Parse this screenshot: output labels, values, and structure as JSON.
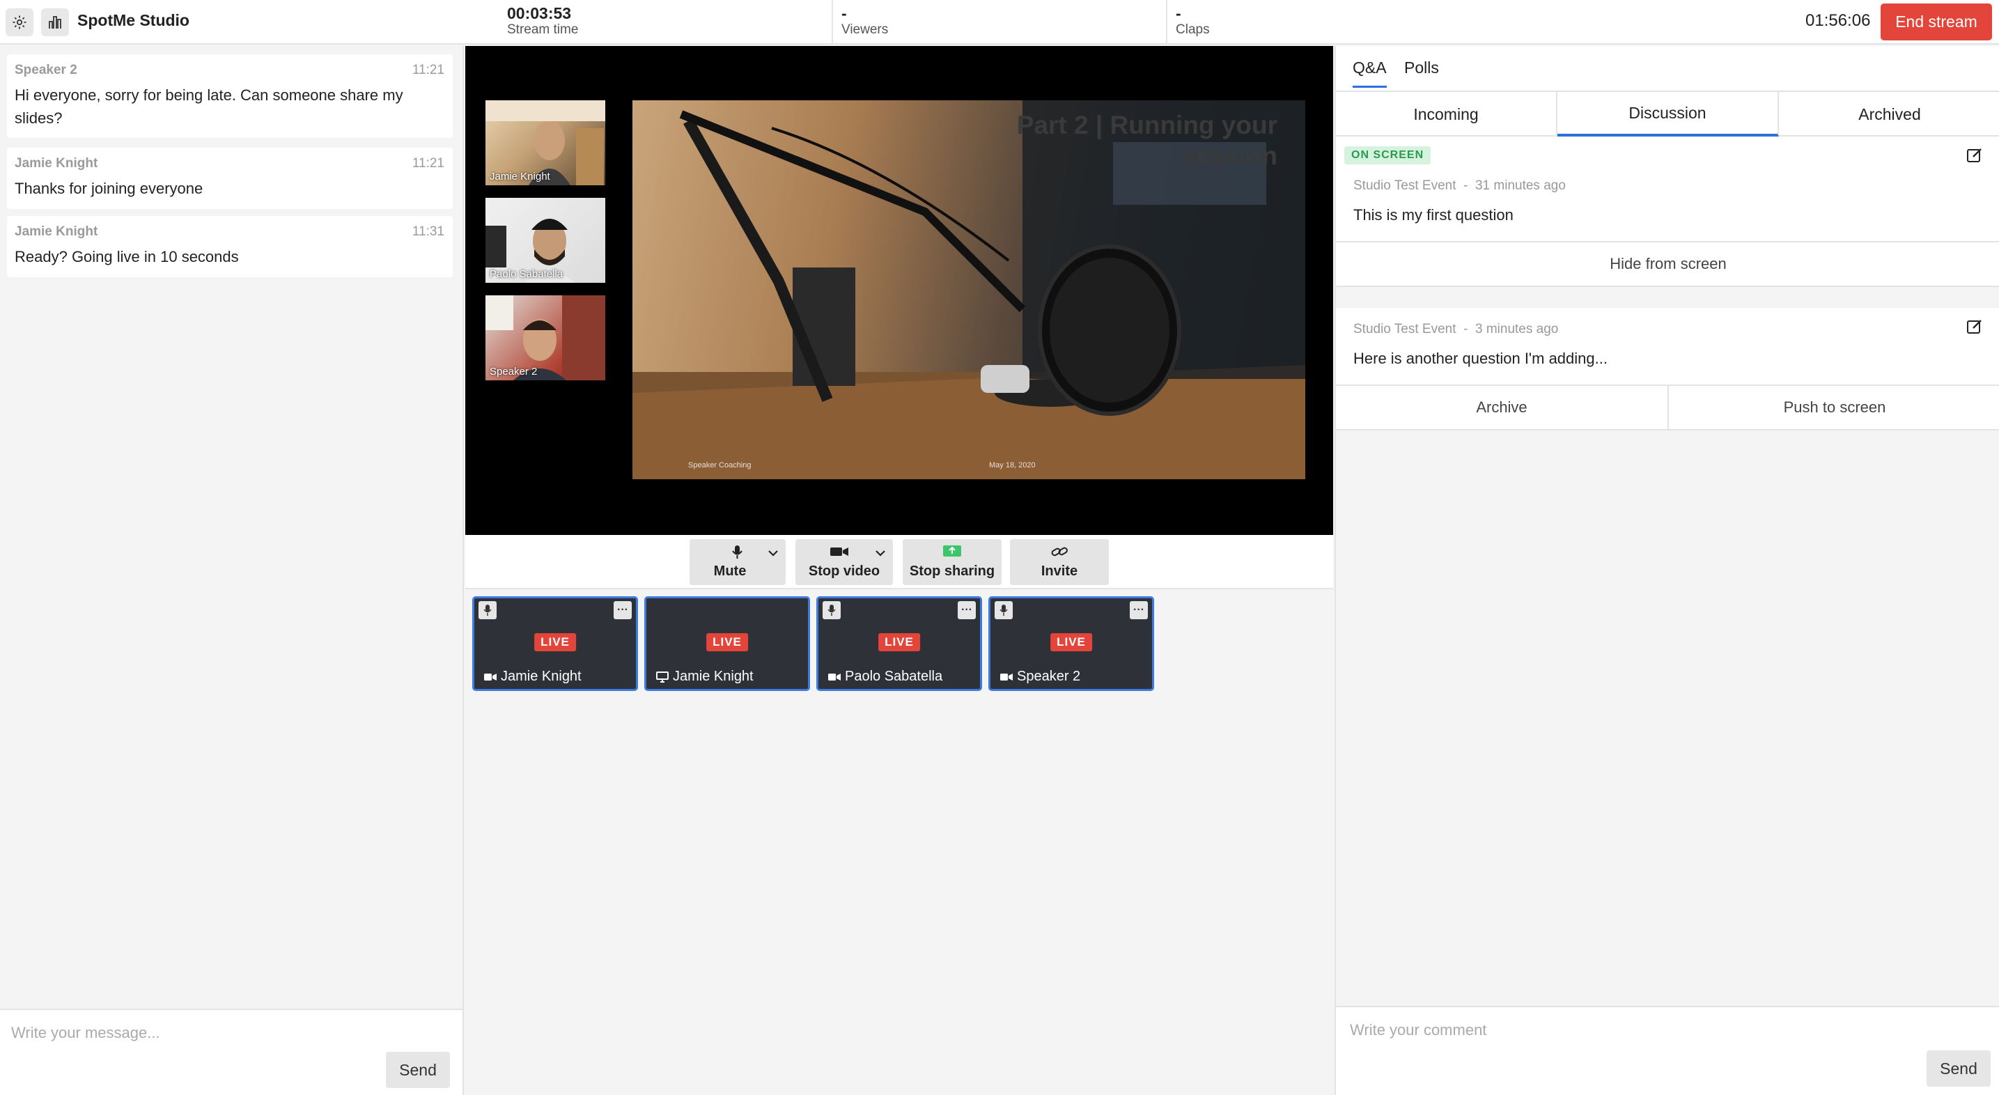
{
  "app": {
    "name": "SpotMe Studio"
  },
  "topbar": {
    "stream_time_value": "00:03:53",
    "stream_time_label": "Stream time",
    "viewers_value": "-",
    "viewers_label": "Viewers",
    "claps_value": "-",
    "claps_label": "Claps",
    "clock": "01:56:06",
    "end_stream_label": "End stream",
    "icons": [
      "gear-icon",
      "bar-chart-icon"
    ]
  },
  "chat": {
    "messages": [
      {
        "author": "Speaker 2",
        "time": "11:21",
        "text": "Hi everyone, sorry for being late. Can someone share my slides?"
      },
      {
        "author": "Jamie Knight",
        "time": "11:21",
        "text": "Thanks for joining everyone"
      },
      {
        "author": "Jamie Knight",
        "time": "11:31",
        "text": "Ready? Going live in 10 seconds"
      }
    ],
    "placeholder": "Write your message...",
    "send_label": "Send"
  },
  "stage": {
    "thumbnails": [
      {
        "name": "Jamie Knight"
      },
      {
        "name": "Paolo Sabatella"
      },
      {
        "name": "Speaker 2"
      }
    ],
    "slide": {
      "title": "Part 2 | Running your session",
      "footer_left": "Speaker Coaching",
      "footer_right": "May 18, 2020"
    }
  },
  "controls": {
    "mute_label": "Mute",
    "stop_video_label": "Stop video",
    "stop_sharing_label": "Stop sharing",
    "invite_label": "Invite"
  },
  "tiles": [
    {
      "name": "Jamie Knight",
      "badge": "LIVE",
      "source": "camera-icon",
      "has_mic": true,
      "has_menu": true
    },
    {
      "name": "Jamie Knight",
      "badge": "LIVE",
      "source": "screen-icon",
      "has_mic": false,
      "has_menu": false
    },
    {
      "name": "Paolo Sabatella",
      "badge": "LIVE",
      "source": "camera-icon",
      "has_mic": true,
      "has_menu": true
    },
    {
      "name": "Speaker 2",
      "badge": "LIVE",
      "source": "camera-icon",
      "has_mic": true,
      "has_menu": true
    }
  ],
  "qa": {
    "tabs": [
      "Q&A",
      "Polls"
    ],
    "subtabs": [
      "Incoming",
      "Discussion",
      "Archived"
    ],
    "active_subtab": "Discussion",
    "questions": [
      {
        "status": "ON SCREEN",
        "source": "Studio Test Event",
        "separator": "-",
        "age": "31 minutes ago",
        "text": "This is my first question",
        "action": "Hide from screen"
      },
      {
        "source": "Studio Test Event",
        "separator": "-",
        "age": "3 minutes ago",
        "text": "Here is another question I'm adding...",
        "actions": [
          "Archive",
          "Push to screen"
        ]
      }
    ],
    "comment_placeholder": "Write your comment",
    "send_label": "Send"
  },
  "colors": {
    "accent": "#2f6fdb",
    "danger": "#e4453a",
    "on_screen_bg": "#d6f3df",
    "on_screen_fg": "#2a9a4c",
    "tile_border": "#3d7be0"
  }
}
